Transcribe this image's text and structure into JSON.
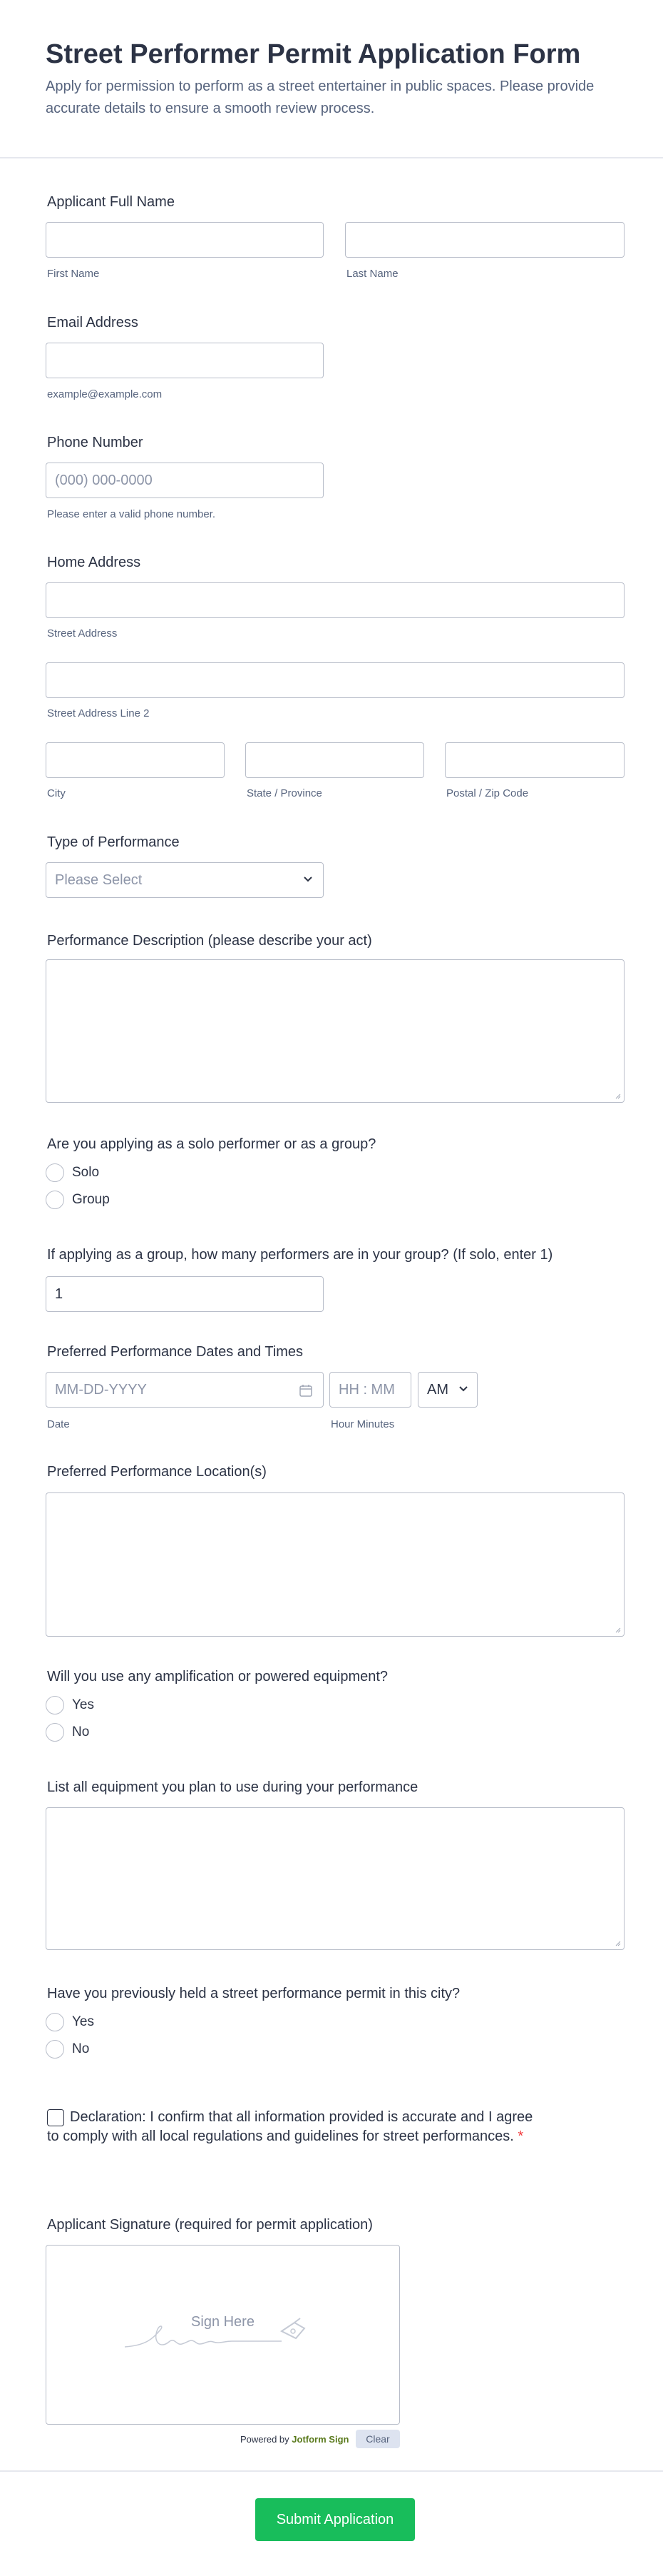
{
  "header": {
    "title": "Street Performer Permit Application Form",
    "description": "Apply for permission to perform as a street entertainer in public spaces. Please provide accurate details to ensure a smooth review process."
  },
  "full_name": {
    "label": "Applicant Full Name",
    "first_sublabel": "First Name",
    "last_sublabel": "Last Name"
  },
  "email": {
    "label": "Email Address",
    "sublabel": "example@example.com"
  },
  "phone": {
    "label": "Phone Number",
    "placeholder": "(000) 000-0000",
    "sublabel": "Please enter a valid phone number."
  },
  "address": {
    "label": "Home Address",
    "street_sublabel": "Street Address",
    "street2_sublabel": "Street Address Line 2",
    "city_sublabel": "City",
    "state_sublabel": "State / Province",
    "zip_sublabel": "Postal / Zip Code"
  },
  "performance_type": {
    "label": "Type of Performance",
    "selected": "Please Select"
  },
  "performance_description": {
    "label": "Performance Description (please describe your act)"
  },
  "solo_or_group": {
    "label": "Are you applying as a solo performer or as a group?",
    "options": [
      "Solo",
      "Group"
    ]
  },
  "group_size": {
    "label": "If applying as a group, how many performers are in your group? (If solo, enter 1)",
    "value": "1"
  },
  "dates": {
    "label": "Preferred Performance Dates and Times",
    "date_placeholder": "MM-DD-YYYY",
    "time_placeholder": "HH : MM",
    "ampm": "AM",
    "date_sublabel": "Date",
    "time_sublabel": "Hour Minutes"
  },
  "locations": {
    "label": "Preferred Performance Location(s)"
  },
  "amplification": {
    "label": "Will you use any amplification or powered equipment?",
    "options": [
      "Yes",
      "No"
    ]
  },
  "equipment": {
    "label": "List all equipment you plan to use during your performance"
  },
  "previous_permit": {
    "label": "Have you previously held a street performance permit in this city?",
    "options": [
      "Yes",
      "No"
    ]
  },
  "declaration": {
    "text": "Declaration: I confirm that all information provided is accurate and I agree to comply with all local regulations and guidelines for street performances.",
    "required_mark": "*"
  },
  "signature": {
    "label": "Applicant Signature (required for permit application)",
    "placeholder": "Sign Here",
    "powered_by": "Powered by",
    "brand": "Jotform Sign",
    "clear_label": "Clear"
  },
  "submit": {
    "label": "Submit Application"
  },
  "colors": {
    "text": "#2c3345",
    "sublabel": "#57647e",
    "border": "#b8bdc9",
    "submit": "#18bd5b",
    "required": "#f23a3c"
  }
}
